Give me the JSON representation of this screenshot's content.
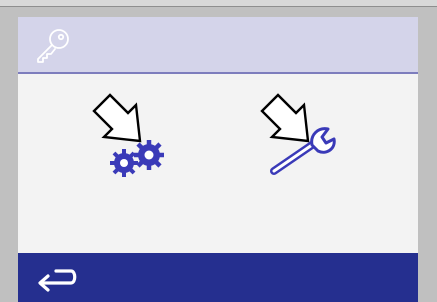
{
  "colors": {
    "frame": "#c0c0c0",
    "screen_bg": "#f3f3f3",
    "header_bg": "#d4d4ea",
    "header_rule": "#7d7dbd",
    "footer_bg": "#252f8f",
    "icon_blue": "#3a3ab8"
  },
  "header": {
    "icon": "key-icon"
  },
  "tiles": [
    {
      "name": "settings",
      "icon": "gears-icon",
      "pointer": "arrow-down-icon"
    },
    {
      "name": "service",
      "icon": "wrench-icon",
      "pointer": "arrow-down-icon"
    }
  ],
  "footer": {
    "back_icon": "back-arrow-icon"
  }
}
